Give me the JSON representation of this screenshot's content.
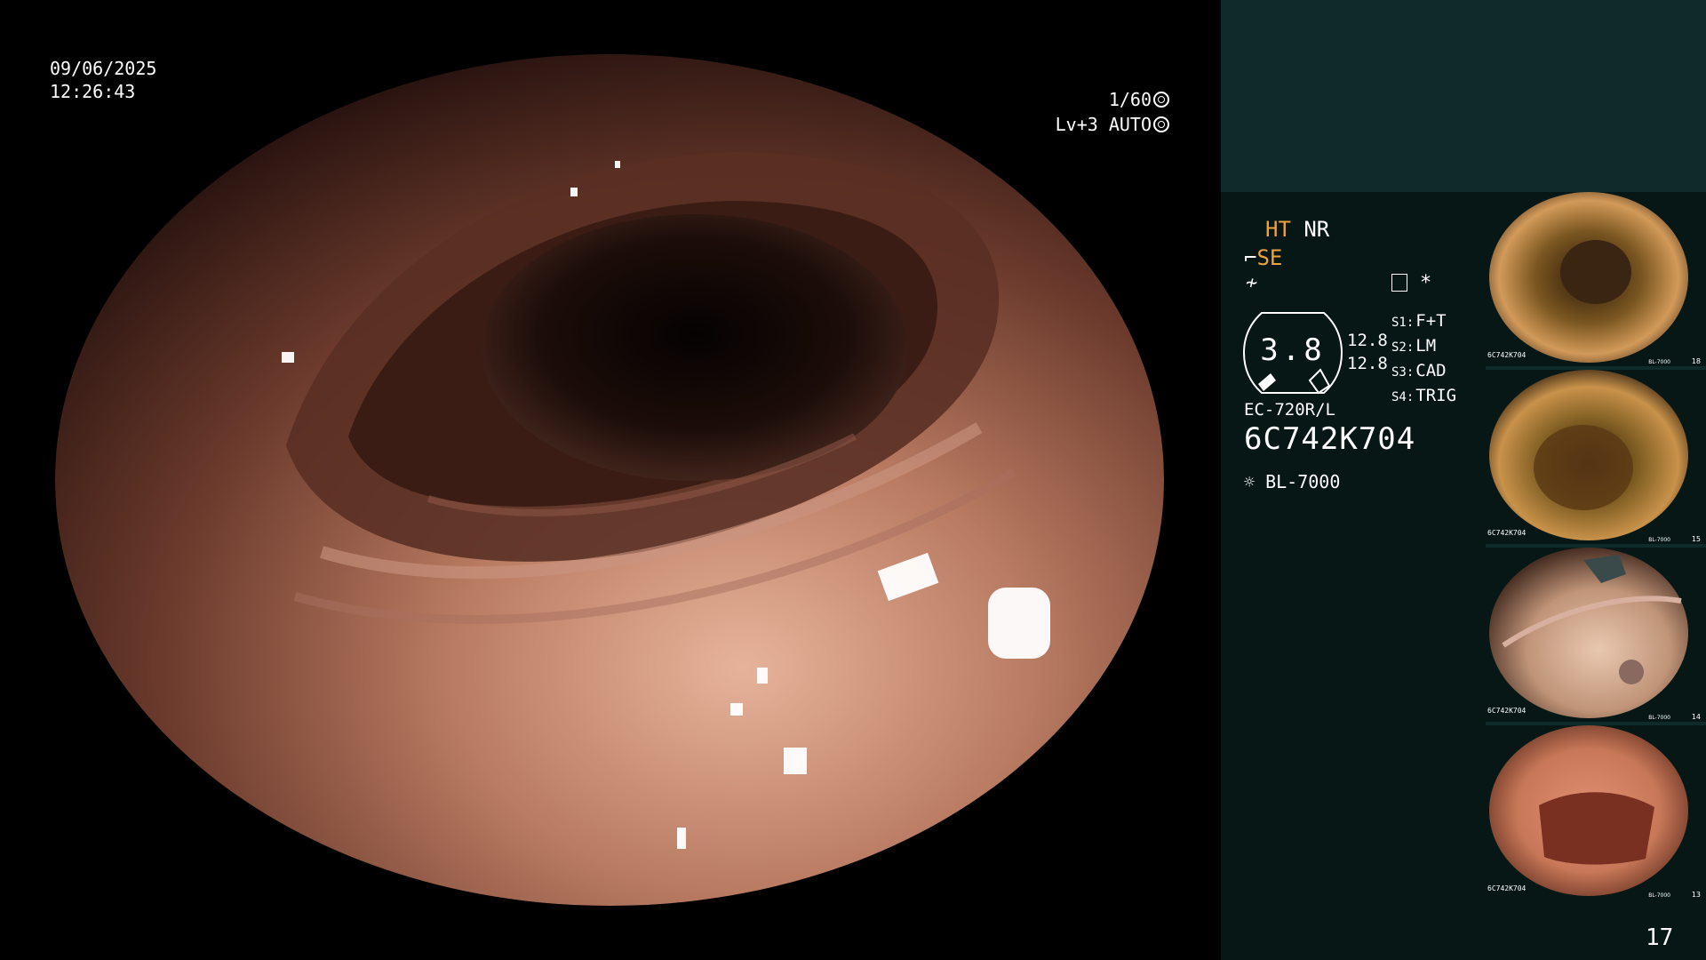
{
  "overlay": {
    "date": "09/06/2025",
    "time": "12:26:43",
    "shutter": "1/60",
    "level": "Lv+3 AUTO"
  },
  "panel": {
    "mode_ht": "HT",
    "mode_nr": "NR",
    "se_label": "SE",
    "freeze_icon": "≁",
    "menu_star": "*",
    "gauge_value": "3.8",
    "zoom_values": [
      "12.8",
      "12.8"
    ],
    "switches": [
      {
        "key": "S1:",
        "value": "F+T"
      },
      {
        "key": "S2:",
        "value": "LM"
      },
      {
        "key": "S3:",
        "value": "CAD"
      },
      {
        "key": "S4:",
        "value": "TRIG"
      }
    ],
    "scope_model": "EC-720R/L",
    "scope_serial": "6C742K704",
    "light_source": "BL-7000",
    "page_number": "17"
  },
  "thumbnails": [
    {
      "label": "6C742K704",
      "index": "18",
      "source": "BL-7000"
    },
    {
      "label": "6C742K704",
      "index": "15",
      "source": "BL-7000"
    },
    {
      "label": "6C742K704",
      "index": "14",
      "source": "BL-7000"
    },
    {
      "label": "6C742K704",
      "index": "13",
      "source": "BL-7000"
    }
  ],
  "colors": {
    "accent_orange": "#f0a23a",
    "panel_top": "#0f2b29",
    "panel_bottom": "#061715"
  }
}
